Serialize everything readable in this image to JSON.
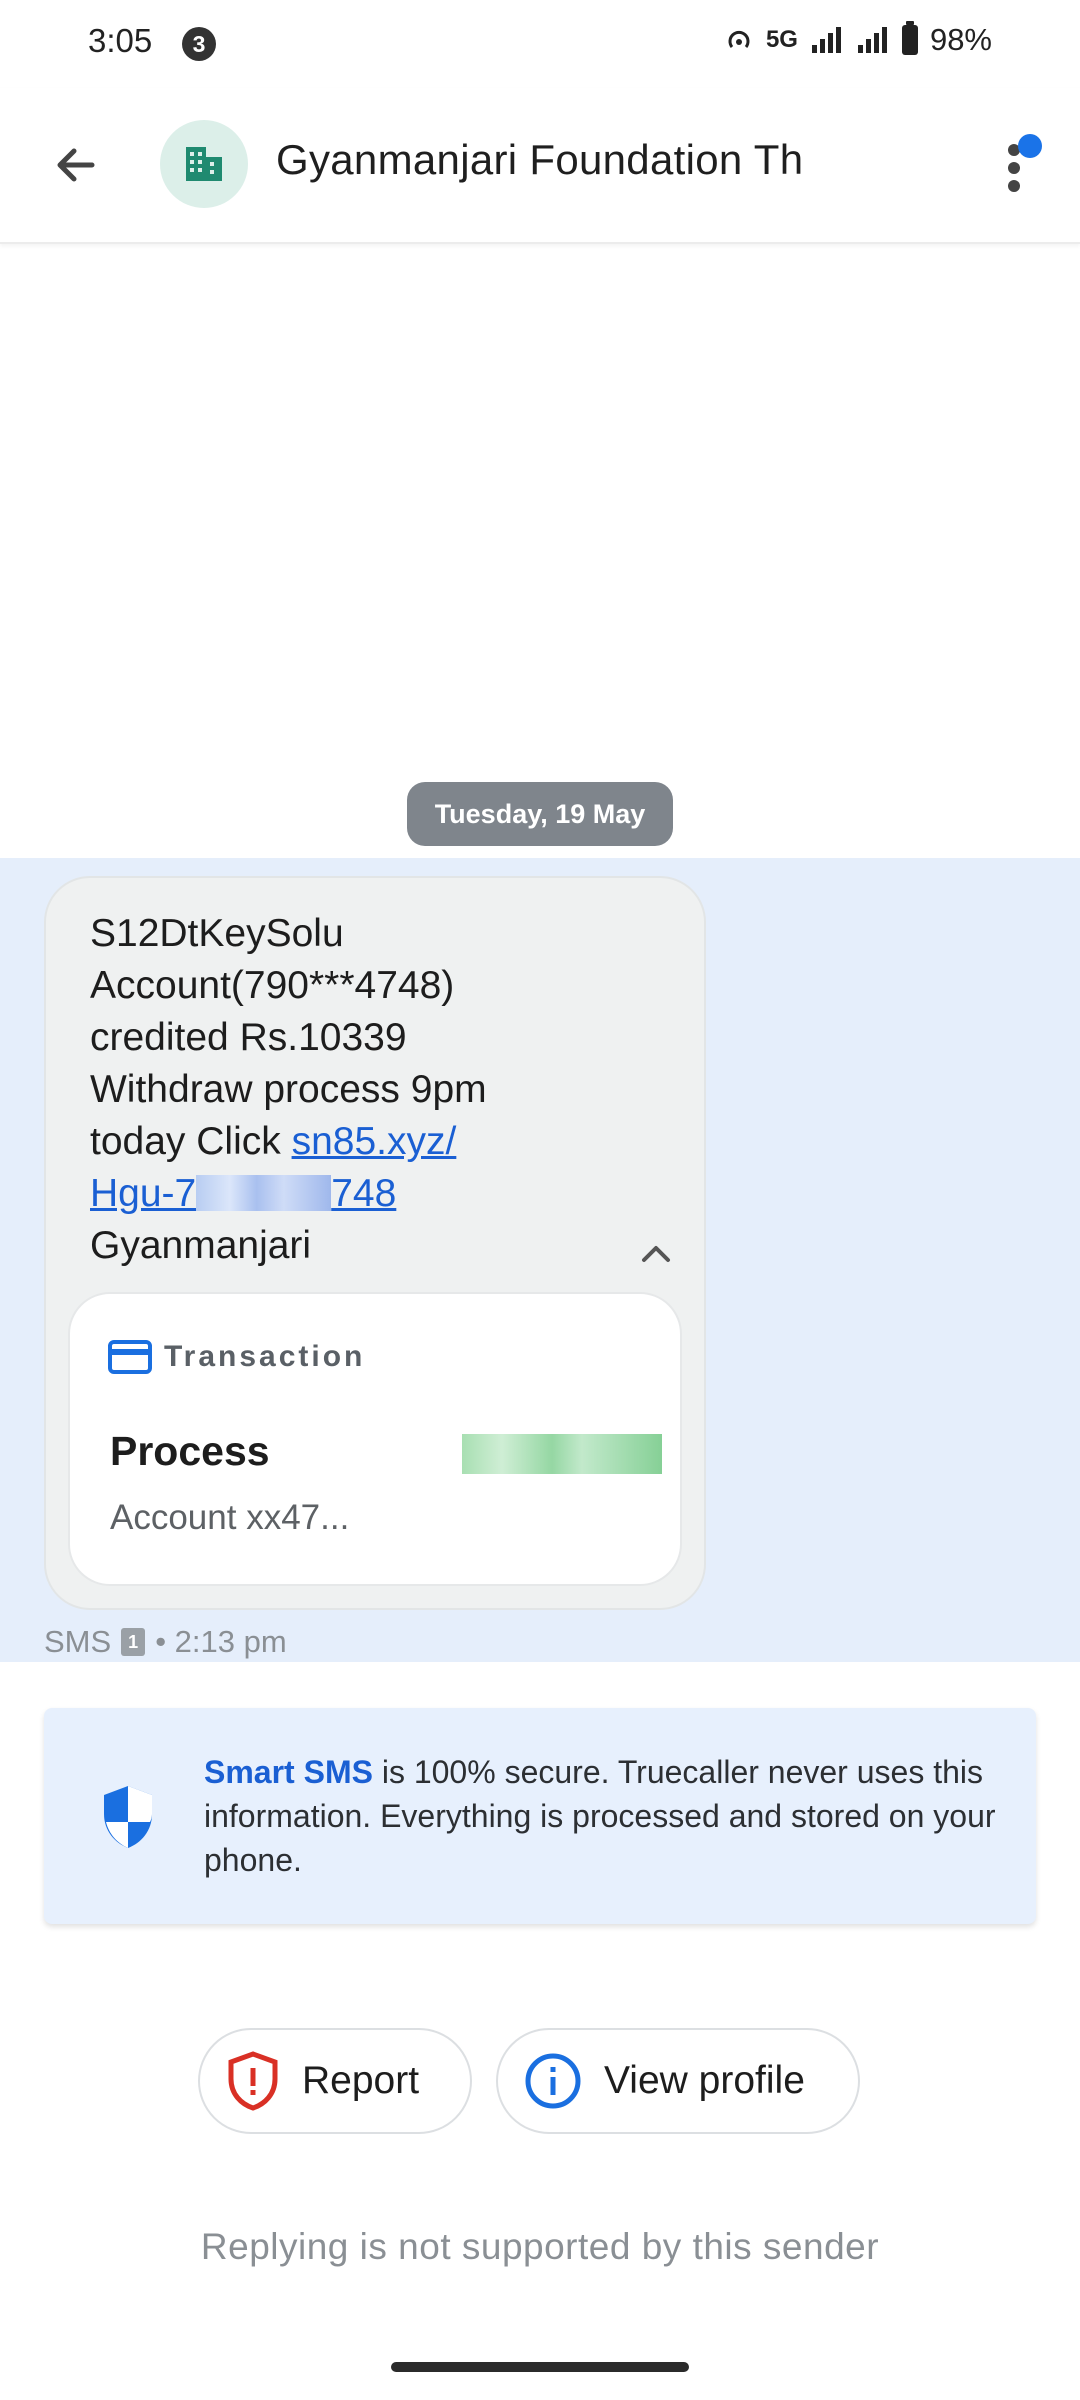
{
  "status_bar": {
    "time": "3:05",
    "notification_count": "3",
    "network": "5G",
    "battery": "98%",
    "icons": [
      "hotspot-icon",
      "signal-icon",
      "signal-icon",
      "battery-icon"
    ]
  },
  "app_bar": {
    "title": "Gyanmanjari Foundation Th",
    "avatar_icon": "building-icon",
    "accent_color": "#1a73e8"
  },
  "conversation": {
    "date_chip": "Tuesday, 19 May",
    "message": {
      "line1": "S12DtKeySolu",
      "line2": "Account(790***4748)",
      "line3": "credited Rs.10339",
      "line4": "Withdraw process  9pm",
      "line5_prefix": "today Click ",
      "link_part1": "sn85.xyz/",
      "link_part2_start": "Hgu-7",
      "link_part2_end": "748",
      "line7": "Gyanmanjari",
      "channel": "SMS",
      "sim": "1",
      "time": "• 2:13 pm"
    },
    "transaction_card": {
      "label": "Transaction",
      "title": "Process",
      "account": "Account xx47..."
    }
  },
  "secure_notice": {
    "brand": "Smart SMS",
    "text": " is 100% secure. Truecaller never uses this information. Everything is processed and stored on your phone."
  },
  "actions": {
    "report_label": "Report",
    "view_profile_label": "View profile"
  },
  "footer": {
    "reply_note": "Replying is not supported by this sender"
  }
}
